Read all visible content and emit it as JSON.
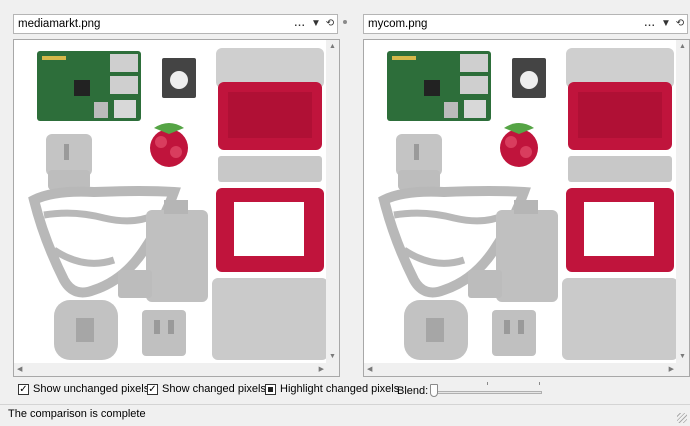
{
  "left": {
    "filename": "mediamarkt.png"
  },
  "right": {
    "filename": "mycom.png"
  },
  "toolbar": {
    "more": "...",
    "dropdown": "▼",
    "history": "⟲"
  },
  "options": {
    "show_unchanged": {
      "label": "Show unchanged pixels",
      "checked": true
    },
    "show_changed": {
      "label": "Show changed pixels",
      "checked": true
    },
    "highlight_changed": {
      "label": "Highlight changed pixels",
      "checked": true
    }
  },
  "blend": {
    "label": "Blend:",
    "value": 0
  },
  "status": "The comparison is complete",
  "colors": {
    "product_red": "#c0143c",
    "gray_overlay": "#c2c2c2",
    "board_green": "#2d6e3a"
  }
}
